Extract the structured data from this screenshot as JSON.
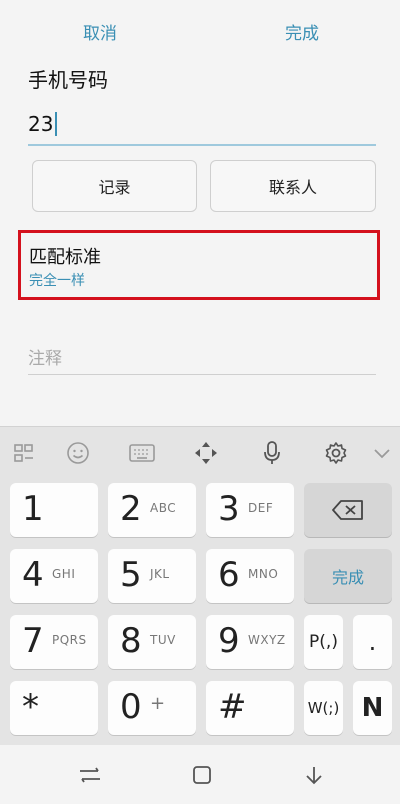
{
  "topbar": {
    "cancel_label": "取消",
    "done_label": "完成"
  },
  "form": {
    "phone_label": "手机号码",
    "phone_value": "23",
    "records_button": "记录",
    "contacts_button": "联系人",
    "match_title": "匹配标准",
    "match_value": "完全一样",
    "note_placeholder": "注释"
  },
  "keyboard_toolbar": {
    "icons": [
      "layout-icon",
      "emoji-icon",
      "keyboard-icon",
      "move-cursor-icon",
      "microphone-icon",
      "settings-icon",
      "chevron-down-icon"
    ]
  },
  "keypad": {
    "keys": [
      {
        "digit": "1",
        "letters": ""
      },
      {
        "digit": "2",
        "letters": "ABC"
      },
      {
        "digit": "3",
        "letters": "DEF"
      },
      {
        "digit": "4",
        "letters": "GHI"
      },
      {
        "digit": "5",
        "letters": "JKL"
      },
      {
        "digit": "6",
        "letters": "MNO"
      },
      {
        "digit": "7",
        "letters": "PQRS"
      },
      {
        "digit": "8",
        "letters": "TUV"
      },
      {
        "digit": "9",
        "letters": "WXYZ"
      },
      {
        "digit": "*",
        "letters": ""
      },
      {
        "digit": "0",
        "letters": "+"
      },
      {
        "digit": "#",
        "letters": ""
      }
    ],
    "done_label": "完成",
    "pause_label": "P(,)",
    "dot_label": ".",
    "wait_label": "W(;)",
    "n_label": "N"
  },
  "colors": {
    "accent": "#3a8fb4",
    "highlight_border": "#d4111d"
  }
}
